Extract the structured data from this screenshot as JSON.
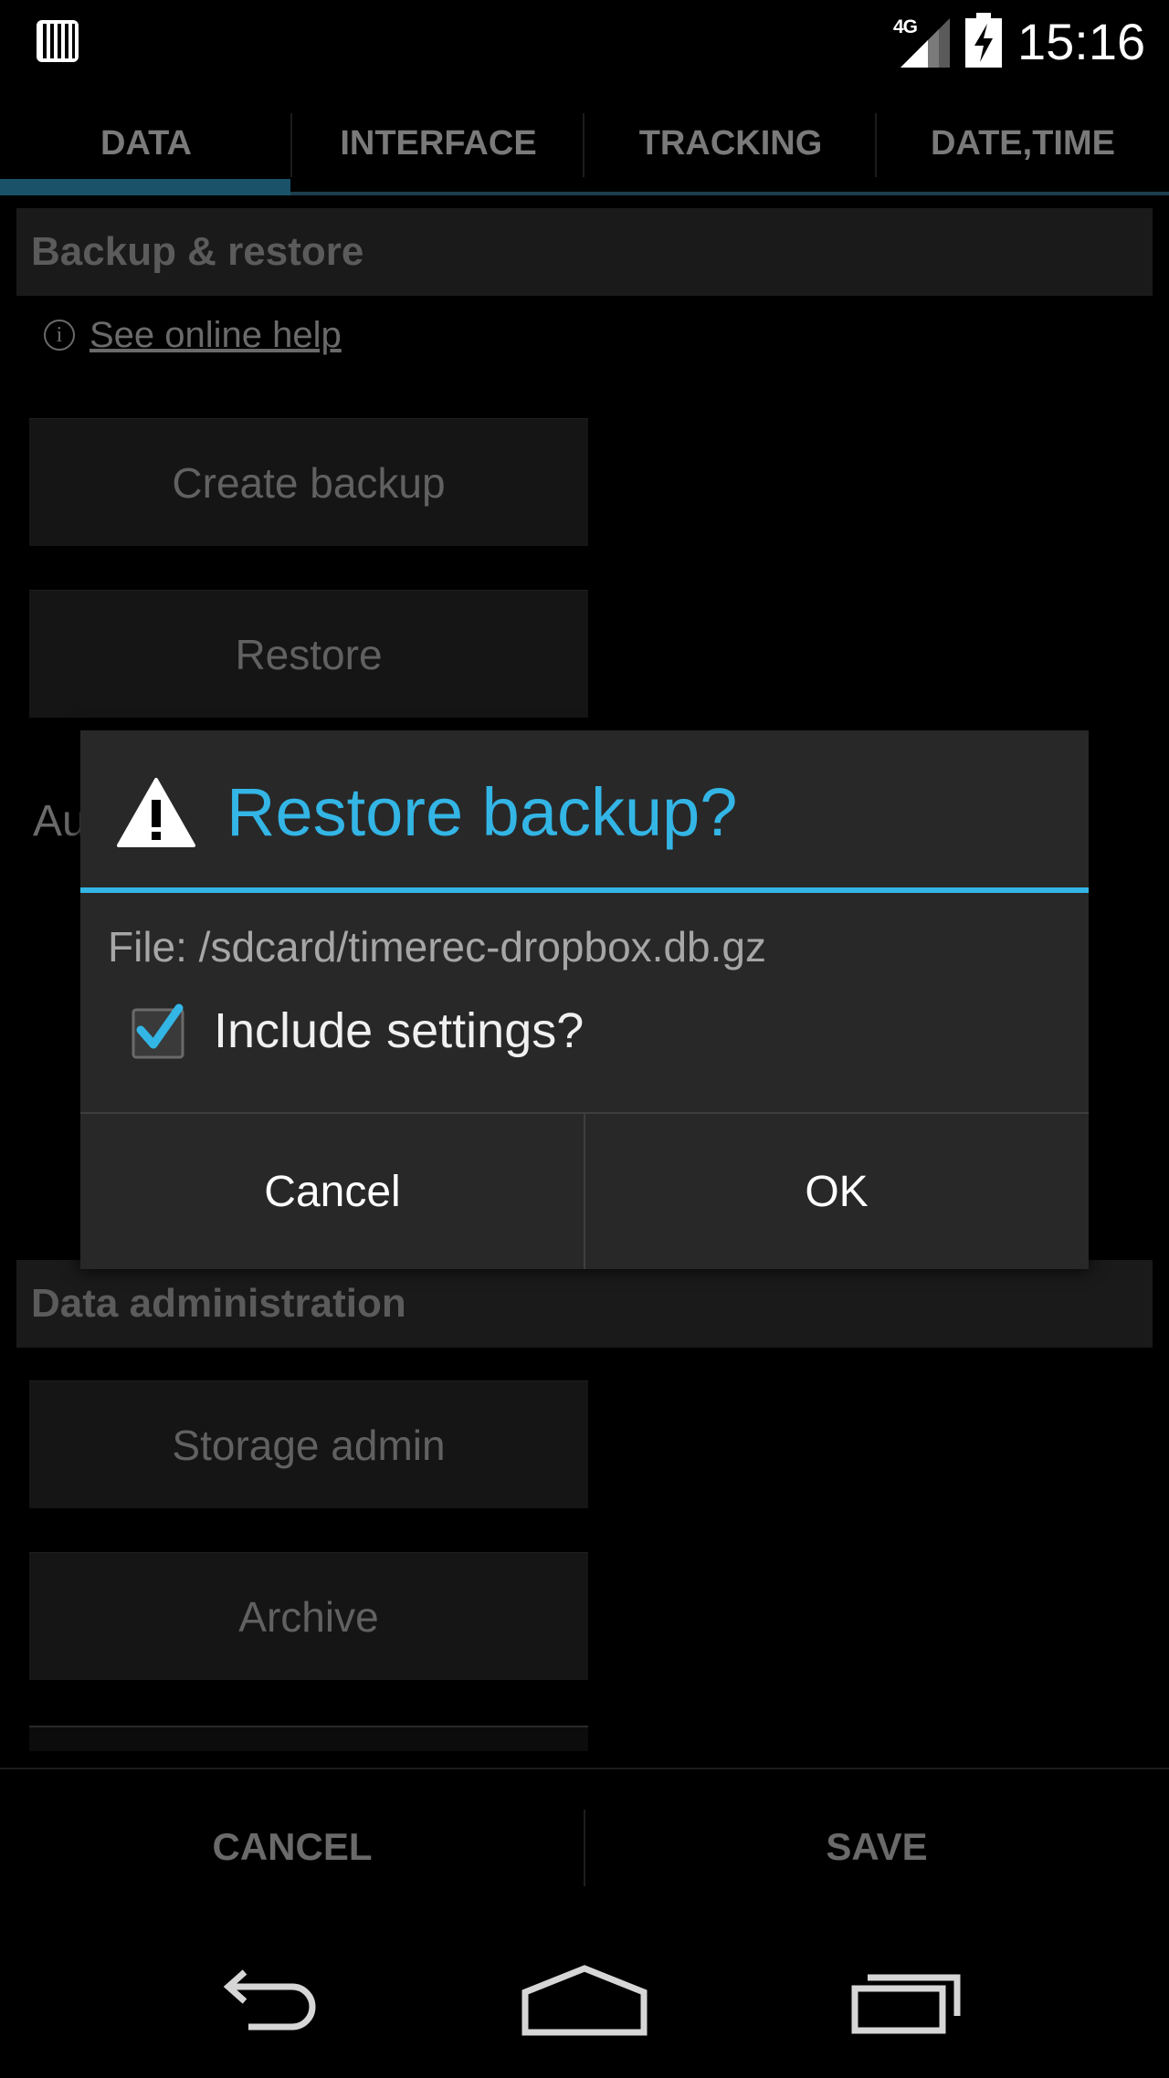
{
  "status_bar": {
    "network": "4G",
    "time": "15:16"
  },
  "tabs": [
    {
      "label": "DATA",
      "active": true
    },
    {
      "label": "INTERFACE",
      "active": false
    },
    {
      "label": "TRACKING",
      "active": false
    },
    {
      "label": "DATE,TIME",
      "active": false
    }
  ],
  "backup_section": {
    "header": "Backup & restore",
    "help_link": "See online help",
    "create_backup": "Create backup",
    "restore": "Restore",
    "partial_label": "Au"
  },
  "data_admin_section": {
    "header": "Data administration",
    "storage_admin": "Storage admin",
    "archive": "Archive"
  },
  "action_bar": {
    "cancel": "CANCEL",
    "save": "SAVE"
  },
  "dialog": {
    "title": "Restore backup?",
    "file_line": "File: /sdcard/timerec-dropbox.db.gz",
    "include_settings_label": "Include settings?",
    "include_settings_checked": true,
    "cancel": "Cancel",
    "ok": "OK"
  },
  "colors": {
    "accent": "#33b5e5",
    "dialog_bg": "#282828"
  },
  "icons": {
    "app": "barcode-icon",
    "battery": "battery-charging-icon",
    "signal": "signal-icon",
    "warning": "warning-icon",
    "info": "info-icon",
    "back": "back-icon",
    "home": "home-icon",
    "recent": "recent-apps-icon"
  }
}
